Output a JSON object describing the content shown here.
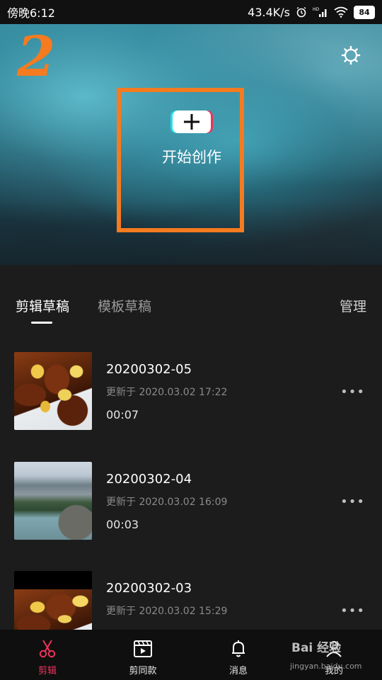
{
  "status_bar": {
    "time": "傍晚6:12",
    "net_speed": "43.4K/s",
    "battery": "84",
    "icons": [
      "alarm-icon",
      "hd-signal-icon",
      "wifi-icon",
      "battery-icon"
    ]
  },
  "hero": {
    "annotation_number": "2",
    "annotation_color": "#f47b20",
    "create_label": "开始创作",
    "settings_icon": "gear-icon",
    "plus_icon": "plus-icon"
  },
  "tabs": {
    "items": [
      {
        "label": "剪辑草稿",
        "active": true
      },
      {
        "label": "模板草稿",
        "active": false
      }
    ],
    "manage_label": "管理"
  },
  "drafts": [
    {
      "title": "20200302-05",
      "updated": "更新于 2020.03.02 17:22",
      "duration": "00:07",
      "thumb": "food"
    },
    {
      "title": "20200302-04",
      "updated": "更新于 2020.03.02 16:09",
      "duration": "00:03",
      "thumb": "mountain"
    },
    {
      "title": "20200302-03",
      "updated": "更新于 2020.03.02 15:29",
      "duration": "",
      "thumb": "food"
    }
  ],
  "more_icon": "more-dots-icon",
  "bottom_nav": {
    "items": [
      {
        "label": "剪辑",
        "icon": "scissors-icon",
        "active": true
      },
      {
        "label": "剪同款",
        "icon": "clapperboard-icon",
        "active": false
      },
      {
        "label": "消息",
        "icon": "bell-icon",
        "active": false
      },
      {
        "label": "我的",
        "icon": "person-icon",
        "active": false
      }
    ],
    "active_color": "#f0325c"
  },
  "watermark": {
    "main": "Bai 经验",
    "sub": "jingyan.baidu.com"
  }
}
